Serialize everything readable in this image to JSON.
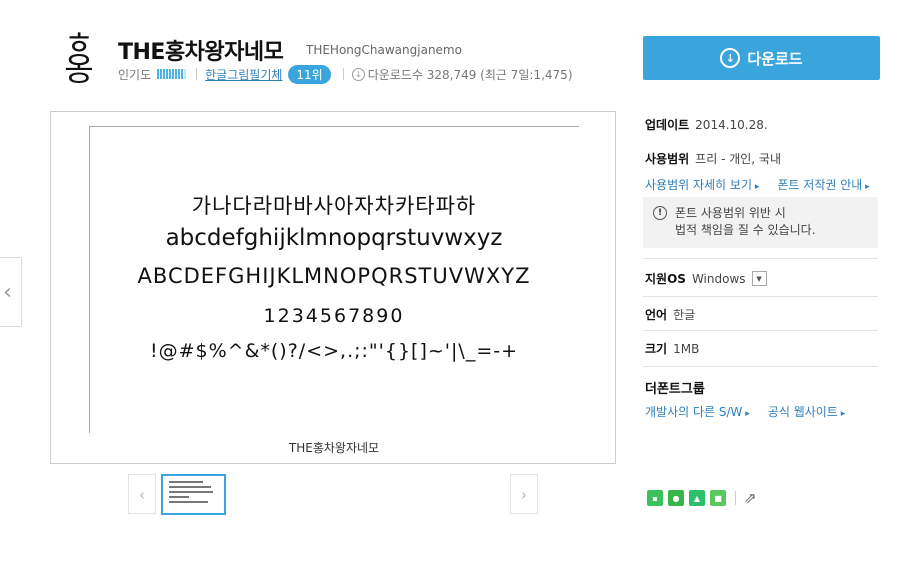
{
  "header": {
    "logo_glyph_top": "ㅎ",
    "logo_glyph_bottom": "옹",
    "title": "THE홍차왕자네모",
    "subtitle": "THEHongChawangjanemo",
    "popularity_label": "인기도",
    "popularity_level": 0.9,
    "category": "한글그림필기체",
    "rank": "11위",
    "downloads": "다운로드수 328,749 (최근 7일:1,475)"
  },
  "download_button": {
    "label": "다운로드"
  },
  "preview": {
    "line1": "가나다라마바사아자차카타파하",
    "line2": "abcdefghijklmnopqrstuvwxyz",
    "line3": "ABCDEFGHIJKLMNOPQRSTUVWXYZ",
    "line4": "1234567890",
    "line5": "!@#$%^&*()?/<>,.;:\"'{}[]~'|\\_=-+",
    "caption": "THE홍차왕자네모"
  },
  "info": {
    "update_label": "업데이트",
    "update_value": "2014.10.28.",
    "usage_label": "사용범위",
    "usage_value": "프리 - 개인, 국내",
    "usage_detail_link": "사용범위 자세히 보기",
    "copyright_link": "폰트 저작권 안내",
    "notice_line1": "폰트 사용범위 위반 시",
    "notice_line2": "법적 책임을 질 수 있습니다.",
    "os_label": "지원OS",
    "os_value": "Windows",
    "lang_label": "언어",
    "lang_value": "한글",
    "size_label": "크기",
    "size_value": "1MB",
    "group_label": "더폰트그룹",
    "dev_link": "개발사의 다른 S/W",
    "site_link": "공식 웹사이트"
  },
  "colors": {
    "accent": "#3aa5dc",
    "link": "#2f7fb8"
  }
}
